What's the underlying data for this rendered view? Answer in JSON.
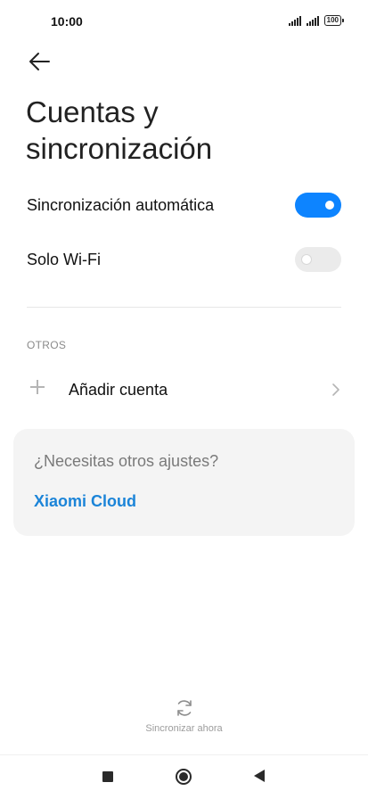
{
  "status_bar": {
    "time": "10:00",
    "battery": "100"
  },
  "page": {
    "title": "Cuentas y sincronización"
  },
  "settings": [
    {
      "label": "Sincronización automática",
      "enabled": true
    },
    {
      "label": "Solo Wi-Fi",
      "enabled": false
    }
  ],
  "section": {
    "header": "OTROS"
  },
  "add_account": {
    "label": "Añadir cuenta"
  },
  "card": {
    "question": "¿Necesitas otros ajustes?",
    "link": "Xiaomi Cloud"
  },
  "sync_now": {
    "label": "Sincronizar ahora"
  },
  "colors": {
    "accent": "#0d84ff",
    "link": "#1b84d8",
    "card_bg": "#f4f4f4"
  },
  "icons": [
    "back-arrow-icon",
    "plus-icon",
    "chevron-right-icon",
    "sync-icon",
    "signal-icon",
    "battery-icon"
  ]
}
